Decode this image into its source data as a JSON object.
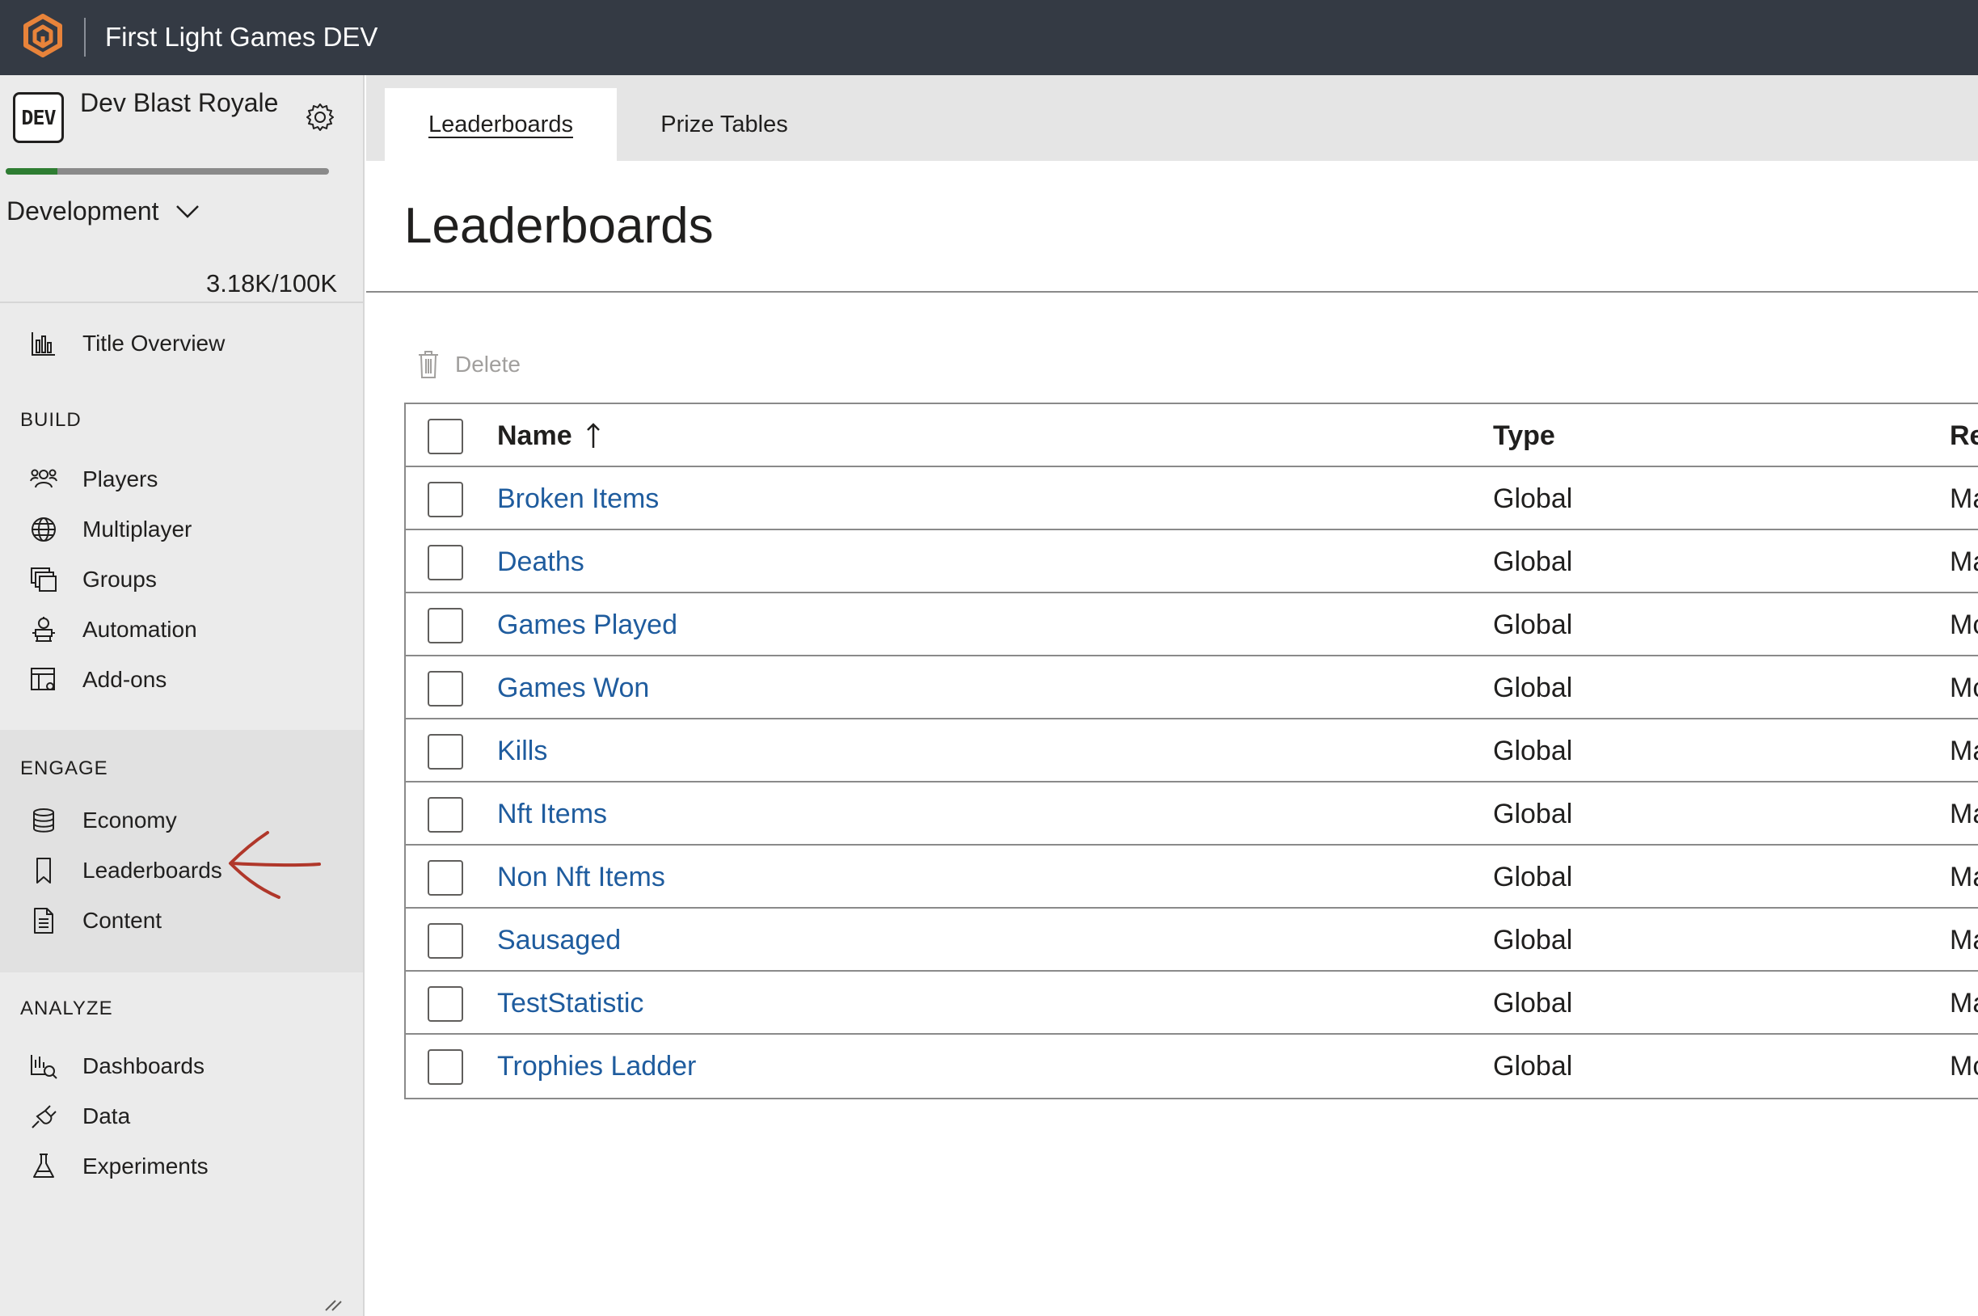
{
  "app": {
    "title": "First Light Games DEV",
    "brand_color": "#e8833a"
  },
  "title_card": {
    "badge": "DEV",
    "game_name": "Dev Blast Royale",
    "environment": "Development",
    "usage": "3.18K/100K",
    "usage_fraction": 0.0318
  },
  "sidebar": {
    "title_overview": "Title Overview",
    "sections": {
      "build": "BUILD",
      "engage": "ENGAGE",
      "analyze": "ANALYZE"
    },
    "build_items": [
      "Players",
      "Multiplayer",
      "Groups",
      "Automation",
      "Add-ons"
    ],
    "engage_items": [
      "Economy",
      "Leaderboards",
      "Content"
    ],
    "analyze_items": [
      "Dashboards",
      "Data",
      "Experiments"
    ]
  },
  "tabs": [
    {
      "label": "Leaderboards",
      "active": true
    },
    {
      "label": "Prize Tables",
      "active": false
    }
  ],
  "page": {
    "title": "Leaderboards",
    "delete_label": "Delete"
  },
  "table": {
    "columns": {
      "name": "Name",
      "type": "Type",
      "reset": "Re"
    },
    "rows": [
      {
        "name": "Broken Items",
        "type": "Global",
        "reset": "Ma"
      },
      {
        "name": "Deaths",
        "type": "Global",
        "reset": "Ma"
      },
      {
        "name": "Games Played",
        "type": "Global",
        "reset": "Mc"
      },
      {
        "name": "Games Won",
        "type": "Global",
        "reset": "Mc"
      },
      {
        "name": "Kills",
        "type": "Global",
        "reset": "Ma"
      },
      {
        "name": "Nft Items",
        "type": "Global",
        "reset": "Ma"
      },
      {
        "name": "Non Nft Items",
        "type": "Global",
        "reset": "Ma"
      },
      {
        "name": "Sausaged",
        "type": "Global",
        "reset": "Ma"
      },
      {
        "name": "TestStatistic",
        "type": "Global",
        "reset": "Ma"
      },
      {
        "name": "Trophies Ladder",
        "type": "Global",
        "reset": "Mc"
      }
    ]
  },
  "colors": {
    "topbar": "#343a44",
    "link": "#1f5c9e",
    "annotation": "#b0372a"
  }
}
